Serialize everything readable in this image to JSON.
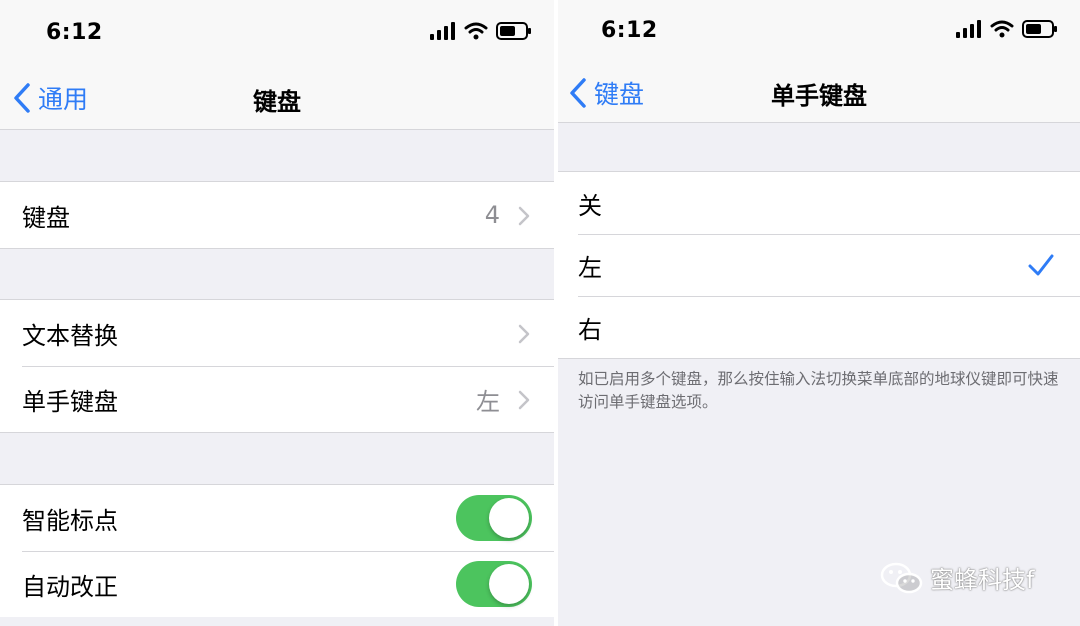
{
  "left_screen": {
    "status_time": "6:12",
    "nav": {
      "back_label": "通用",
      "title": "键盘"
    },
    "rows": [
      {
        "label": "键盘",
        "value": "4"
      },
      {
        "label": "文本替换",
        "value": ""
      },
      {
        "label": "单手键盘",
        "value": "左"
      },
      {
        "label": "智能标点",
        "toggle": true
      },
      {
        "label": "自动改正",
        "toggle": true
      }
    ]
  },
  "right_screen": {
    "status_time": "6:12",
    "nav": {
      "back_label": "键盘",
      "title": "单手键盘"
    },
    "options": [
      {
        "label": "关",
        "selected": false
      },
      {
        "label": "左",
        "selected": true
      },
      {
        "label": "右",
        "selected": false
      }
    ],
    "footer": "如已启用多个键盘，那么按住输入法切换菜单底部的地球仪键即可快速访问单手键盘选项。"
  },
  "watermark": "蜜蜂科技f",
  "colors": {
    "accent": "#2f7cf6",
    "toggle_on": "#4cc45e",
    "group_bg": "#f0f0f5"
  }
}
